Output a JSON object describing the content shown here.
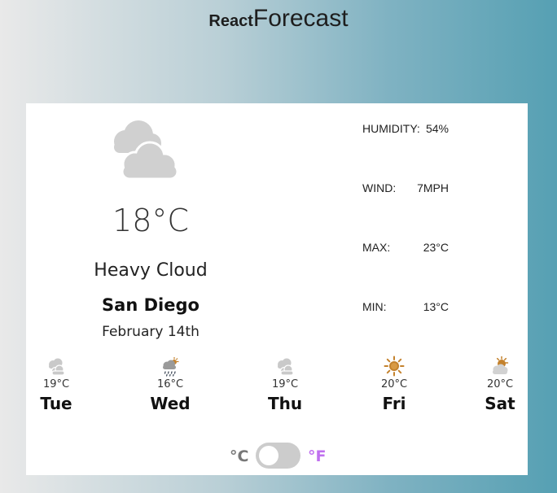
{
  "header": {
    "brand_prefix": "React",
    "brand_name": "Forecast"
  },
  "current": {
    "icon": "cloud-icon",
    "temperature": "18°C",
    "description": "Heavy Cloud",
    "city": "San Diego",
    "date": "February 14th"
  },
  "stats": [
    {
      "label": "HUMIDITY:",
      "value": "54%"
    },
    {
      "label": "WIND:",
      "value": "7MPH"
    },
    {
      "label": "MAX:",
      "value": "23°C"
    },
    {
      "label": "MIN:",
      "value": "13°C"
    }
  ],
  "forecast": [
    {
      "day": "Tue",
      "temp": "19°C",
      "icon": "cloud-icon"
    },
    {
      "day": "Wed",
      "temp": "16°C",
      "icon": "rain-sun-icon"
    },
    {
      "day": "Thu",
      "temp": "19°C",
      "icon": "cloud-icon"
    },
    {
      "day": "Fri",
      "temp": "20°C",
      "icon": "sun-icon"
    },
    {
      "day": "Sat",
      "temp": "20°C",
      "icon": "partly-cloudy-icon"
    }
  ],
  "units": {
    "celsius": "°C",
    "fahrenheit": "°F",
    "selected": "celsius"
  },
  "colors": {
    "fahrenheit_accent": "#c070ef",
    "sun": "#c4822d",
    "cloud": "#c9c9c9"
  }
}
